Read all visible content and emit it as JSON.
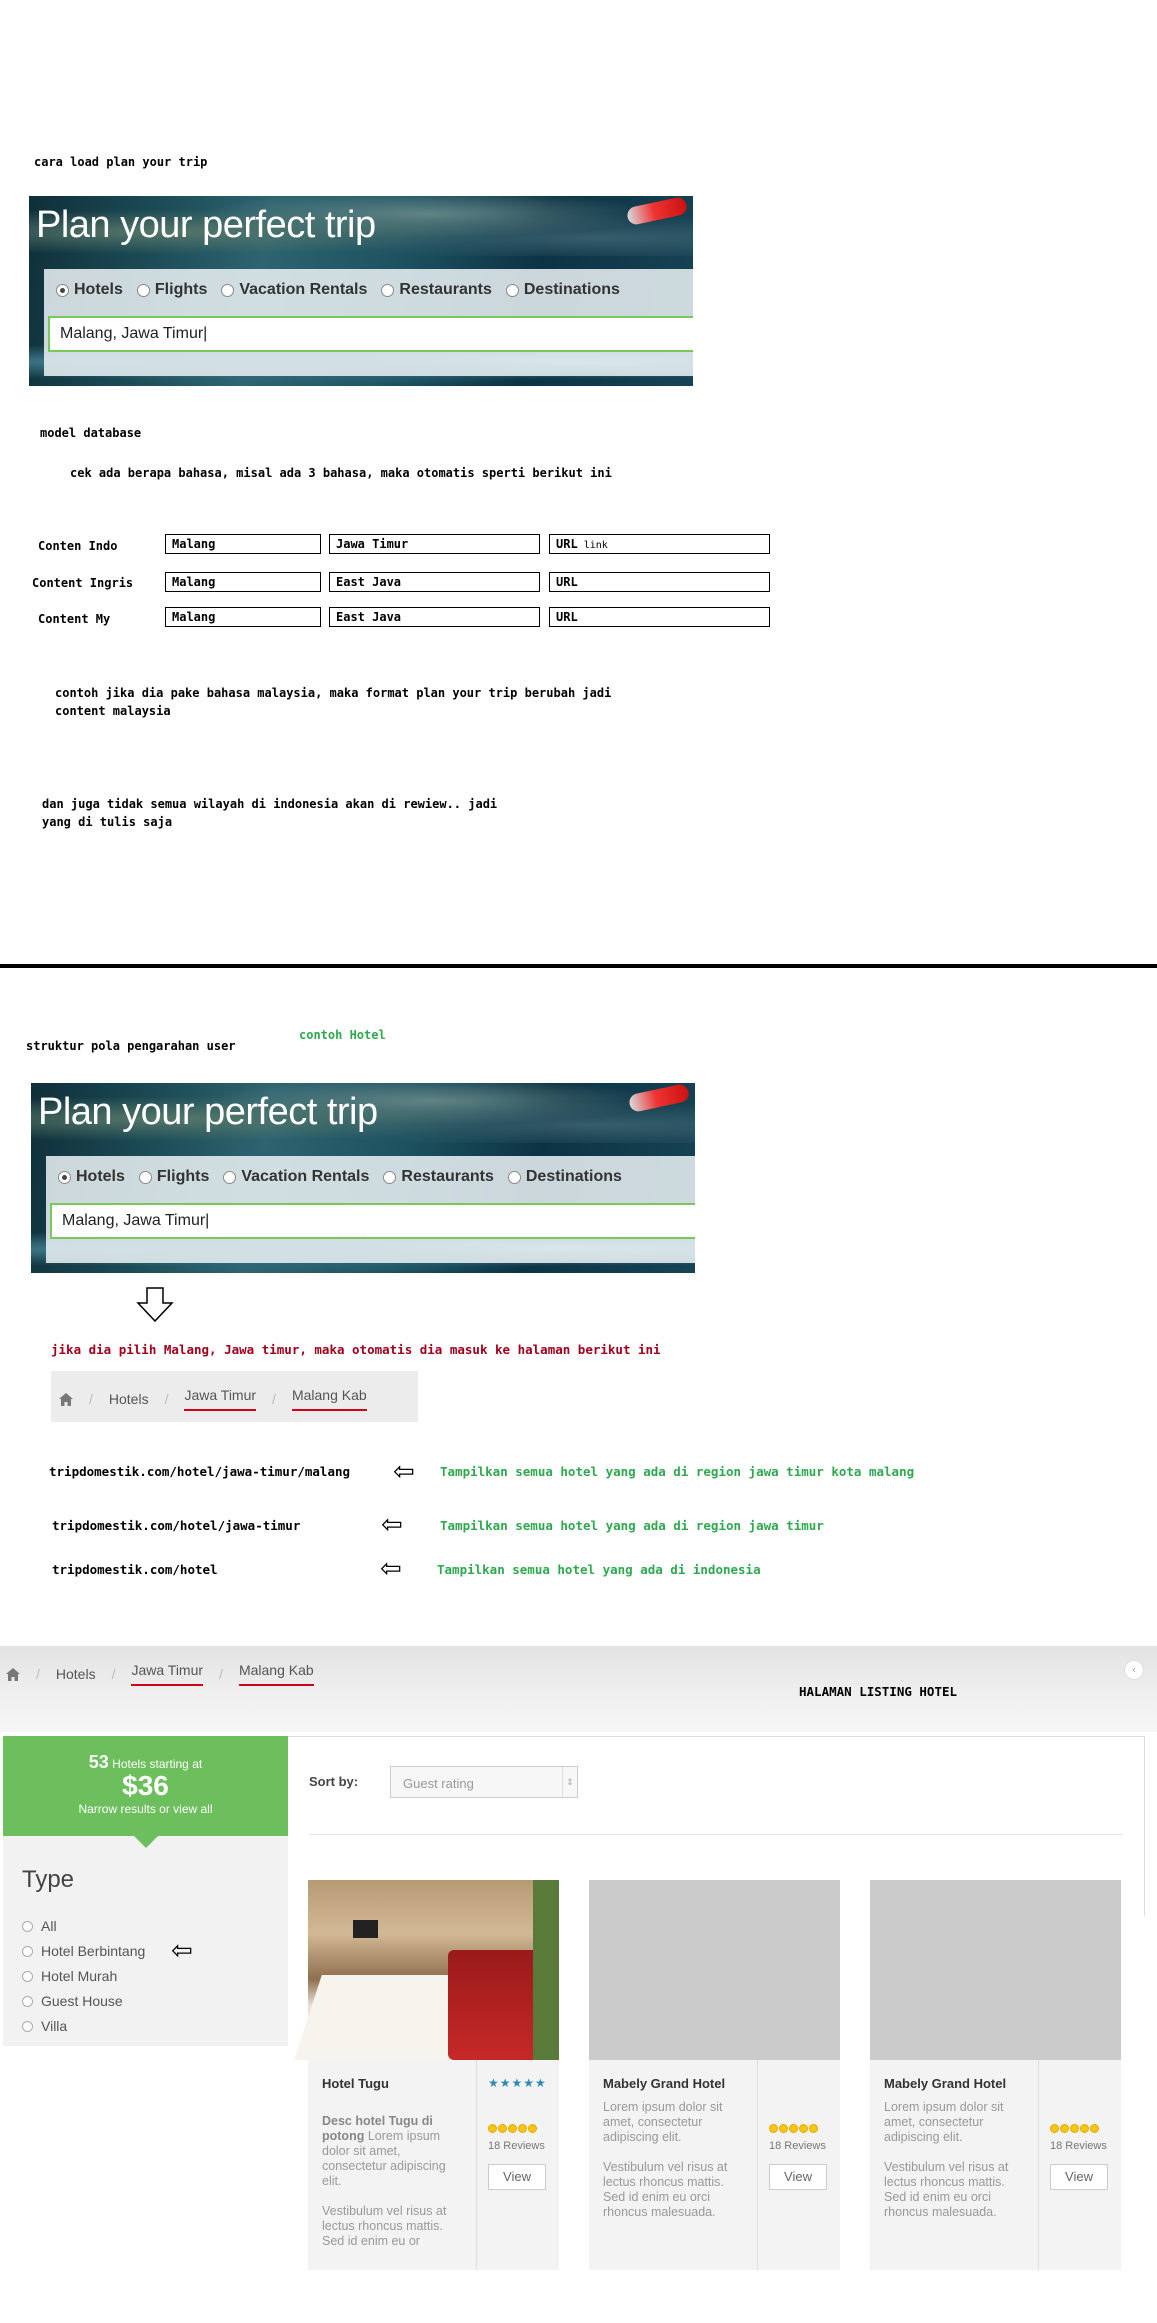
{
  "notes": {
    "load_plan": "cara load plan your trip",
    "model_db": "model database",
    "cek_bahasa": "cek ada berapa bahasa, misal ada 3 bahasa, maka otomatis sperti berikut ini",
    "contoh_malaysia_1": "contoh jika dia pake bahasa malaysia, maka format plan your trip berubah jadi",
    "contoh_malaysia_2": "content malaysia",
    "tidak_semua_1": "dan juga tidak semua wilayah di indonesia akan di rewiew.. jadi",
    "tidak_semua_2": "yang di tulis saja",
    "struktur": "struktur pola pengarahan user",
    "contoh_hotel": "contoh Hotel",
    "jika_pilih": "jika dia pilih Malang, Jawa timur, maka otomatis dia masuk ke halaman berikut ini",
    "halaman_listing": "HALAMAN LISTING HOTEL"
  },
  "plan_widget": {
    "title": "Plan your perfect trip",
    "options": [
      "Hotels",
      "Flights",
      "Vacation Rentals",
      "Restaurants",
      "Destinations"
    ],
    "selected": "Hotels",
    "input_value": "Malang, Jawa Timur"
  },
  "db_rows": [
    {
      "label": "Conten Indo",
      "city": "Malang",
      "region": "Jawa Timur",
      "url": "URL",
      "url_note": "link"
    },
    {
      "label": "Content Ingris",
      "city": "Malang",
      "region": "East Java",
      "url": "URL",
      "url_note": ""
    },
    {
      "label": "Content My",
      "city": "Malang",
      "region": "East Java",
      "url": "URL",
      "url_note": ""
    }
  ],
  "breadcrumb": {
    "items": [
      "Hotels",
      "Jawa Timur",
      "Malang Kab"
    ]
  },
  "url_map": [
    {
      "url": "tripdomestik.com/hotel/jawa-timur/malang",
      "desc": "Tampilkan semua hotel yang ada di region jawa timur kota malang"
    },
    {
      "url": "tripdomestik.com/hotel/jawa-timur",
      "desc": "Tampilkan semua hotel yang ada di region jawa timur"
    },
    {
      "url": "tripdomestik.com/hotel",
      "desc": "Tampilkan semua hotel yang ada di indonesia"
    }
  ],
  "listing": {
    "promo": {
      "count": "53",
      "count_suffix": "Hotels starting at",
      "price": "$36",
      "sub": "Narrow results or view all"
    },
    "sort_label": "Sort by:",
    "sort_placeholder": "Guest rating",
    "type_title": "Type",
    "type_options": [
      "All",
      "Hotel Berbintang",
      "Hotel Murah",
      "Guest House",
      "Villa"
    ],
    "cards": [
      {
        "name": "Hotel Tugu",
        "desc_bold": "Desc hotel Tugu di potong",
        "desc": "Lorem ipsum dolor sit amet, consectetur adipiscing elit.",
        "desc2": "Vestibulum vel risus at lectus rhoncus mattis. Sed id enim eu or",
        "reviews": "18 Reviews",
        "view": "View",
        "stars": "★★★★★"
      },
      {
        "name": "Mabely Grand Hotel",
        "desc_bold": "",
        "desc": "Lorem ipsum dolor sit amet, consectetur adipiscing elit.",
        "desc2": "Vestibulum vel risus at lectus rhoncus mattis. Sed id enim eu orci rhoncus malesuada.",
        "reviews": "18 Reviews",
        "view": "View",
        "stars": ""
      },
      {
        "name": "Mabely Grand Hotel",
        "desc_bold": "",
        "desc": "Lorem ipsum dolor sit amet, consectetur adipiscing elit.",
        "desc2": "Vestibulum vel risus at lectus rhoncus mattis. Sed id enim eu orci rhoncus malesuada.",
        "reviews": "18 Reviews",
        "view": "View",
        "stars": ""
      }
    ]
  },
  "colors": {
    "accent_green": "#6cbf5c",
    "underline_red": "#d0021b",
    "note_green": "#2fa84f",
    "note_red": "#a0001c"
  }
}
